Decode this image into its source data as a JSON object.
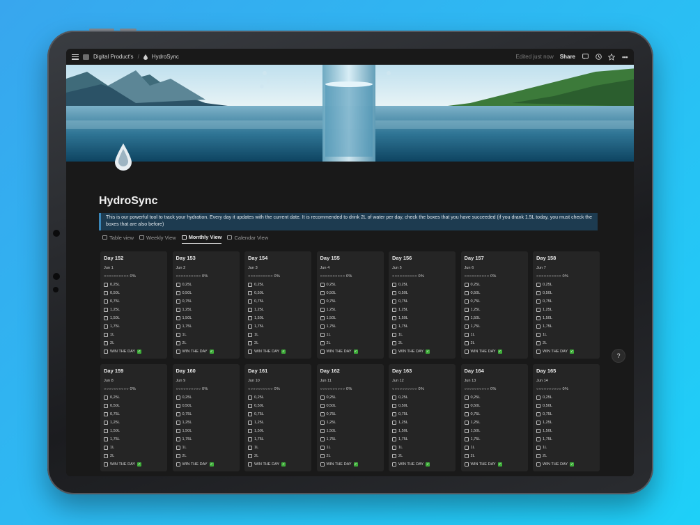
{
  "breadcrumb": {
    "parent": "Digital Product's",
    "separator": "/",
    "current": "HydroSync"
  },
  "topbar": {
    "edited": "Edited just now",
    "share": "Share"
  },
  "title": "HydroSync",
  "callout": "This is our powerful tool to track your hydration. Every day it updates with the current date. It is recommended to drink 2L of water per day, check the boxes that you have succeeded (if you drank 1.5L today, you must check the boxes that are also before)",
  "views": [
    {
      "label": "Table view"
    },
    {
      "label": "Weekly View"
    },
    {
      "label": "Monthly View",
      "active": true
    },
    {
      "label": "Calendar View"
    }
  ],
  "checklist": [
    "0,25L",
    "0,50L",
    "0,75L",
    "1,25L",
    "1,50L",
    "1,75L",
    "1L",
    "2L"
  ],
  "win_label": "WIN THE DAY",
  "progress_text": "○○○○○○○○○○ 0%",
  "cards": [
    {
      "day": "Day 152",
      "date": "Jun 1"
    },
    {
      "day": "Day 153",
      "date": "Jun 2"
    },
    {
      "day": "Day 154",
      "date": "Jun 3"
    },
    {
      "day": "Day 155",
      "date": "Jun 4"
    },
    {
      "day": "Day 156",
      "date": "Jun 5"
    },
    {
      "day": "Day 157",
      "date": "Jun 6"
    },
    {
      "day": "Day 158",
      "date": "Jun 7"
    },
    {
      "day": "Day 159",
      "date": "Jun 8"
    },
    {
      "day": "Day 160",
      "date": "Jun 9"
    },
    {
      "day": "Day 161",
      "date": "Jun 10"
    },
    {
      "day": "Day 162",
      "date": "Jun 11"
    },
    {
      "day": "Day 163",
      "date": "Jun 12"
    },
    {
      "day": "Day 164",
      "date": "Jun 13"
    },
    {
      "day": "Day 165",
      "date": "Jun 14"
    }
  ],
  "help": "?",
  "colors": {
    "callout_bg": "#1d3b50",
    "card_bg": "#252525",
    "win_check": "#3fae3a"
  }
}
